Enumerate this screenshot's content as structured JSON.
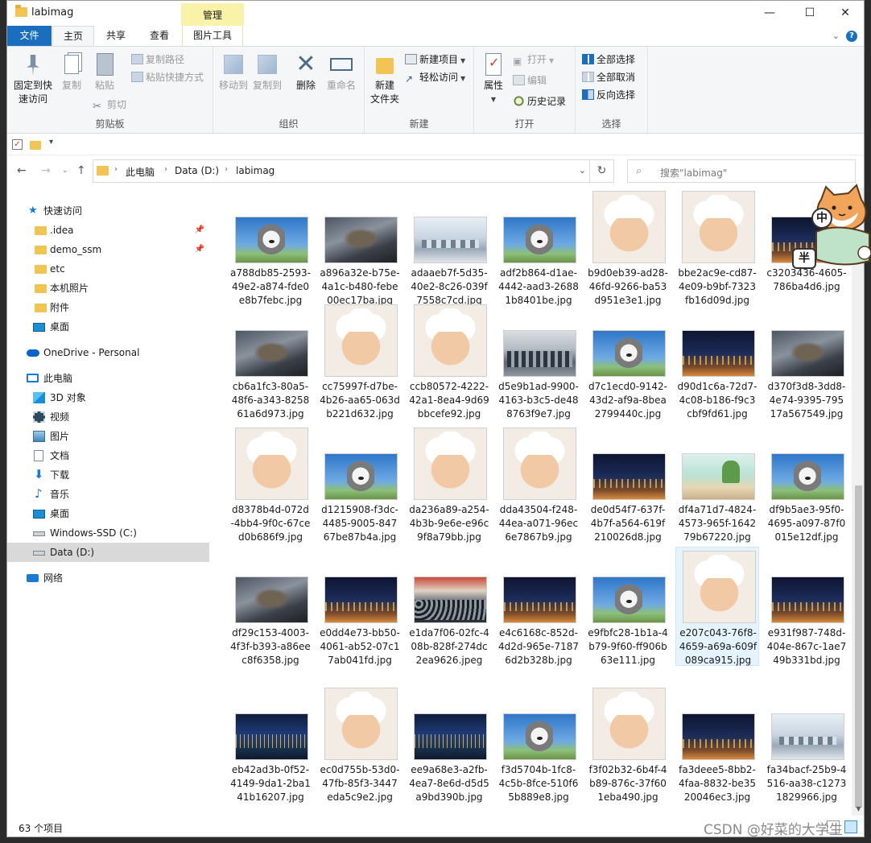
{
  "window": {
    "title": "labimag",
    "context_tab": "管理",
    "controls": {
      "minimize": "—",
      "maximize": "☐",
      "close": "✕"
    }
  },
  "ribbon_tabs": [
    "文件",
    "主页",
    "共享",
    "查看",
    "图片工具"
  ],
  "ribbon_right": {
    "collapse": "⌄",
    "help": "?"
  },
  "ribbon": {
    "clipboard": {
      "label": "剪贴板",
      "pin_label_1": "固定到快",
      "pin_label_2": "速访问",
      "copy": "复制",
      "paste": "粘贴",
      "copy_path": "复制路径",
      "paste_shortcut": "粘贴快捷方式",
      "cut": "剪切"
    },
    "organize": {
      "label": "组织",
      "move_to": "移动到",
      "copy_to": "复制到",
      "delete": "删除",
      "rename": "重命名"
    },
    "new": {
      "label": "新建",
      "new_folder_1": "新建",
      "new_folder_2": "文件夹",
      "new_item": "新建项目",
      "easy_access": "轻松访问"
    },
    "open": {
      "label": "打开",
      "properties": "属性",
      "open": "打开",
      "edit": "编辑",
      "history": "历史记录"
    },
    "select": {
      "label": "选择",
      "select_all": "全部选择",
      "select_none": "全部取消",
      "invert": "反向选择"
    }
  },
  "address": {
    "crumbs": [
      "此电脑",
      "Data (D:)",
      "labimag"
    ],
    "search_placeholder": "搜索\"labimag\""
  },
  "nav": {
    "quick_access": "快速访问",
    "quick_items": [
      ".idea",
      "demo_ssm",
      "etc",
      "本机照片",
      "附件",
      "桌面"
    ],
    "onedrive": "OneDrive - Personal",
    "this_pc": "此电脑",
    "pc_items": [
      "3D 对象",
      "视频",
      "图片",
      "文档",
      "下载",
      "音乐",
      "桌面",
      "Windows-SSD (C:)",
      "Data (D:)"
    ],
    "network": "网络"
  },
  "files": [
    [
      "a788db85-2593-49e2-a874-fde0e8b7febc.jpg",
      "husky"
    ],
    [
      "a896a32e-b75e-4a1c-b480-febe00ec17ba.jpg",
      "monster"
    ],
    [
      "adaaeb7f-5d35-40e2-8c26-039f7558c7cd.jpg",
      "lab"
    ],
    [
      "adf2b864-d1ae-4442-aad3-26881b8401be.jpg",
      "husky"
    ],
    [
      "b9d0eb39-ad28-46fd-9266-ba53d951e3e1.jpg",
      "sheep"
    ],
    [
      "bbe2ac9e-cd87-4e09-b9bf-7323fb16d09d.jpg",
      "sheep"
    ],
    [
      "c3203436-4605-786ba4d6.jpg",
      "night"
    ],
    [
      "cb6a1fc3-80a5-48f6-a343-825861a6d973.jpg",
      "monster"
    ],
    [
      "cc75997f-d7be-4b26-aa65-063db221d632.jpg",
      "sheep"
    ],
    [
      "ccb80572-4222-42a1-8ea4-9d69bbcefe92.jpg",
      "sheep"
    ],
    [
      "d5e9b1ad-9900-4163-b3c5-de488763f9e7.jpg",
      "classroom"
    ],
    [
      "d7c1ecd0-9142-43d2-af9a-8bea2799440c.jpg",
      "husky"
    ],
    [
      "d90d1c6a-72d7-4c08-b186-f9c3cbf9fd61.jpg",
      "night"
    ],
    [
      "d370f3d8-3dd8-4e74-9395-79517a567549.jpg",
      "monster"
    ],
    [
      "d8378b4d-072d-4bb4-9f0c-67ced0b686f9.jpg",
      "sheep"
    ],
    [
      "d1215908-f3dc-4485-9005-84767be87b4a.jpg",
      "husky"
    ],
    [
      "da236a89-a254-4b3b-9e6e-e96c9f8a79bb.jpg",
      "sheep"
    ],
    [
      "dda43504-f248-44ea-a071-96ec6e7867b9.jpg",
      "sheep"
    ],
    [
      "de0d54f7-637f-4b7f-a564-619f210026d8.jpg",
      "night"
    ],
    [
      "df4a71d7-4824-4573-965f-164279b67220.jpg",
      "room"
    ],
    [
      "df9b5ae3-95f0-4695-a097-87f0015e12df.jpg",
      "husky"
    ],
    [
      "df29c153-4003-4f3f-b393-a86eec8f6358.jpg",
      "monster"
    ],
    [
      "e0dd4e73-bb50-4061-ab52-07c17ab041fd.jpg",
      "night"
    ],
    [
      "e1da7f06-02fc-408b-828f-274dc2ea9626.jpeg",
      "crowd"
    ],
    [
      "e4c6168c-852d-4d2d-965e-71876d2b328b.jpg",
      "night"
    ],
    [
      "e9fbfc28-1b1a-4b79-9f60-ff906b63e111.jpg",
      "husky"
    ],
    [
      "e207c043-76f8-4659-a69a-609f089ca915.jpg",
      "sheep"
    ],
    [
      "e931f987-748d-404e-867c-1ae749b331bd.jpg",
      "night"
    ],
    [
      "eb42ad3b-0f52-4149-9da1-2ba141b16207.jpg",
      "city"
    ],
    [
      "ec0d755b-53d0-47fb-85f3-3447eda5c9e2.jpg",
      "sheep"
    ],
    [
      "ee9a68e3-a2fb-4ea7-8e6d-d5d5a9bd390b.jpg",
      "city"
    ],
    [
      "f3d5704b-1fc8-4c5b-8fce-510f65b889e8.jpg",
      "husky"
    ],
    [
      "f3f02b32-6b4f-4b89-876c-37f601eba490.jpg",
      "sheep"
    ],
    [
      "fa3deee5-8bb2-4faa-8832-be3520046ec3.jpg",
      "night"
    ],
    [
      "fa34bacf-25b9-4516-aa38-c12731829966.jpg",
      "lab"
    ]
  ],
  "selected_file_index": 26,
  "status": {
    "count": "63 个项目"
  },
  "sticker": {
    "char_1": "中",
    "char_2": "半"
  },
  "watermark": "CSDN @好菜的大学生",
  "colors": {
    "accent": "#1a6ebd",
    "context_tab": "#f9f3a9",
    "selection": "#e5f3ff"
  }
}
